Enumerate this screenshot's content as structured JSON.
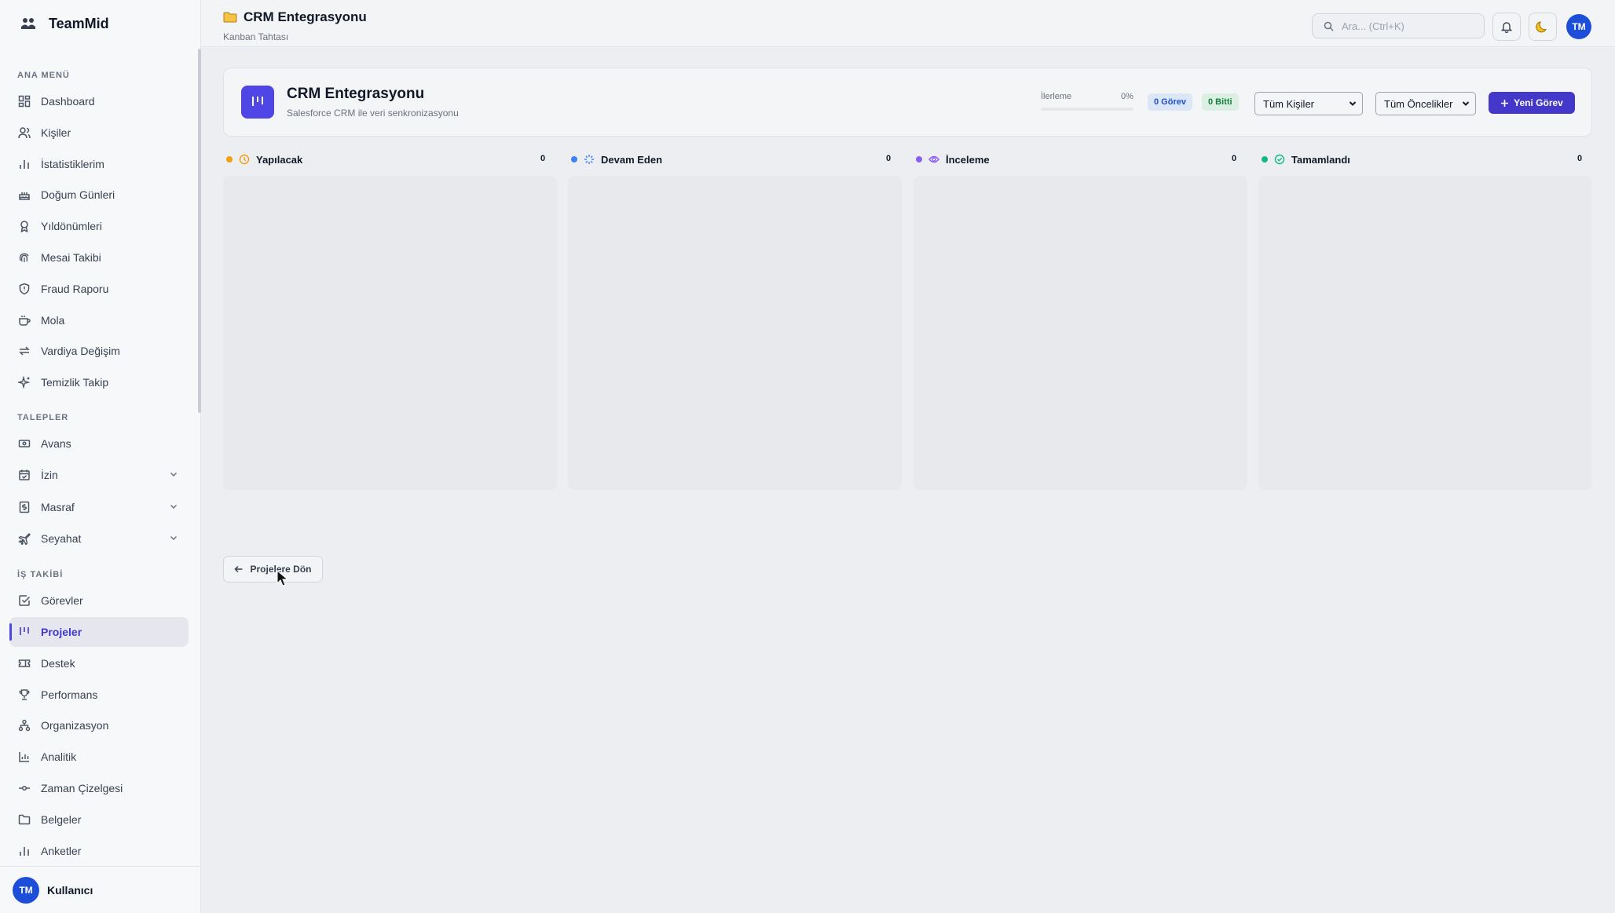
{
  "app": {
    "name": "TeamMid"
  },
  "sidebar": {
    "sections": {
      "main": "ANA MENÜ",
      "requests": "TALEPLER",
      "work": "İŞ TAKİBİ"
    },
    "items": {
      "dashboard": "Dashboard",
      "people": "Kişiler",
      "stats": "İstatistiklerim",
      "birthdays": "Doğum Günleri",
      "anniversaries": "Yıldönümleri",
      "overtime": "Mesai Takibi",
      "fraud": "Fraud Raporu",
      "break": "Mola",
      "shift": "Vardiya Değişim",
      "cleaning": "Temizlik Takip",
      "advance": "Avans",
      "leave": "İzin",
      "expense": "Masraf",
      "travel": "Seyahat",
      "tasks": "Görevler",
      "projects": "Projeler",
      "support": "Destek",
      "performance": "Performans",
      "organization": "Organizasyon",
      "analytics": "Analitik",
      "timeline": "Zaman Çizelgesi",
      "documents": "Belgeler",
      "surveys": "Anketler"
    },
    "user": {
      "initials": "TM",
      "name": "Kullanıcı"
    }
  },
  "topbar": {
    "title": "CRM Entegrasyonu",
    "subtitle": "Kanban Tahtası",
    "search_placeholder": "Ara... (Ctrl+K)",
    "avatar_initials": "TM"
  },
  "project": {
    "title": "CRM Entegrasyonu",
    "description": "Salesforce CRM ile veri senkronizasyonu",
    "progress_label": "İlerleme",
    "progress_value": "0%",
    "progress_fraction": 0,
    "tasks_badge": "0 Görev",
    "done_badge": "0 Bitti",
    "people_filter": "Tüm Kişiler",
    "priority_filter": "Tüm Öncelikler",
    "new_task_label": "Yeni Görev"
  },
  "columns": [
    {
      "name": "Yapılacak",
      "count": "0",
      "color": "#f59e0b"
    },
    {
      "name": "Devam Eden",
      "count": "0",
      "color": "#3b82f6"
    },
    {
      "name": "İnceleme",
      "count": "0",
      "color": "#8b5cf6"
    },
    {
      "name": "Tamamlandı",
      "count": "0",
      "color": "#10b981"
    }
  ],
  "back_button": "Projelere Dön",
  "colors": {
    "accent": "#4f46e5",
    "avatar": "#1d4ed8"
  }
}
